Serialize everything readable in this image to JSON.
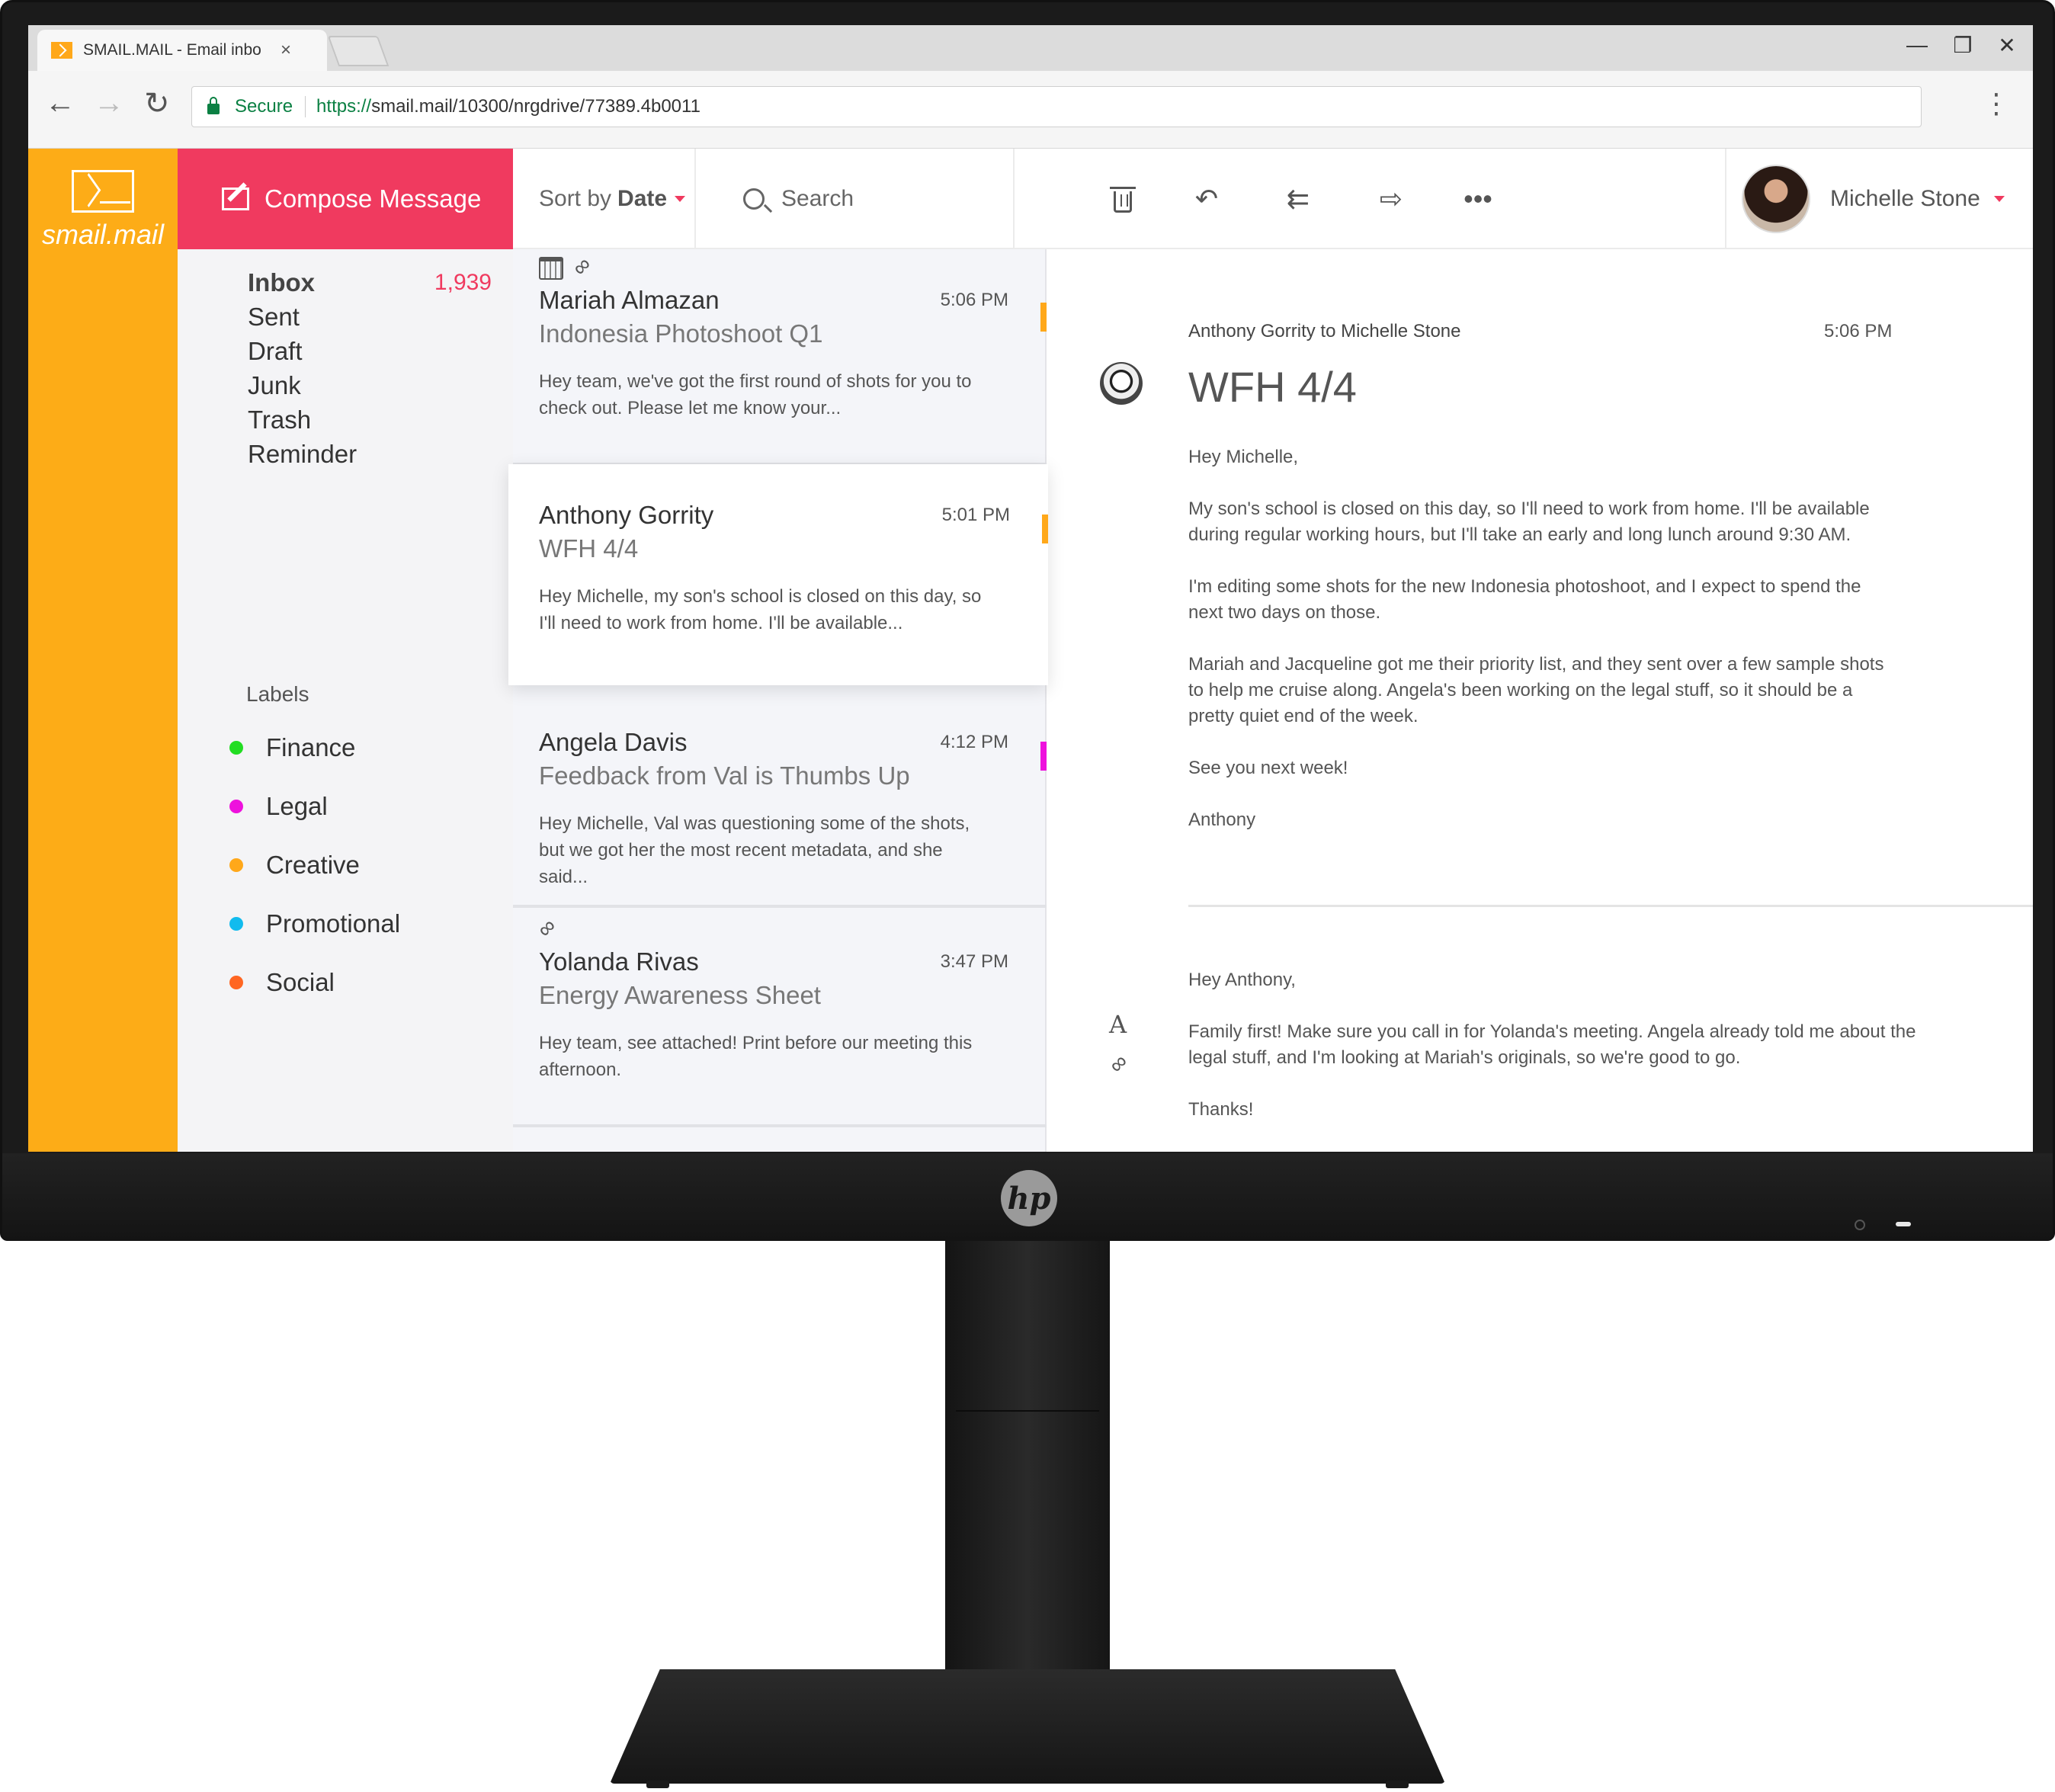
{
  "browser": {
    "tab_title": "SMAIL.MAIL - Email inbo",
    "tab_close": "×",
    "secure_label": "Secure",
    "url_scheme": "https://",
    "url_rest": "smail.mail/10300/nrgdrive/77389.4b0011",
    "window_controls": [
      "—",
      "❐",
      "✕"
    ]
  },
  "app": {
    "brand_name": "smail.mail",
    "compose_label": "Compose Message",
    "folders": [
      {
        "label": "Inbox",
        "count": "1,939"
      },
      {
        "label": "Sent"
      },
      {
        "label": "Draft"
      },
      {
        "label": "Junk"
      },
      {
        "label": "Trash"
      },
      {
        "label": "Reminder"
      }
    ],
    "labels_title": "Labels",
    "labels": [
      {
        "label": "Finance",
        "color": "#22dd22"
      },
      {
        "label": "Legal",
        "color": "#ee11dd"
      },
      {
        "label": "Creative",
        "color": "#ffa81a"
      },
      {
        "label": "Promotional",
        "color": "#11bbee"
      },
      {
        "label": "Social",
        "color": "#ff6622"
      }
    ]
  },
  "toolbar": {
    "sort_prefix": "Sort by",
    "sort_value": "Date",
    "search_placeholder": "Search",
    "actions": [
      "delete-icon",
      "reply-icon",
      "reply-all-icon",
      "forward-icon",
      "more-icon"
    ]
  },
  "user": {
    "name": "Michelle Stone"
  },
  "messages": [
    {
      "sender": "Mariah Almazan",
      "subject": "Indonesia Photoshoot Q1",
      "time": "5:06 PM",
      "preview": "Hey team, we've got the first round of shots for you to check out. Please let me know your...",
      "flag_color": "#ffa81a",
      "icons": [
        "calendar-icon",
        "link-icon"
      ]
    },
    {
      "sender": "Anthony Gorrity",
      "subject": "WFH 4/4",
      "time": "5:01 PM",
      "preview": "Hey Michelle, my son's school is closed on this day, so I'll need to work from home. I'll be available...",
      "flag_color": "#ffa81a",
      "icons": []
    },
    {
      "sender": "Angela Davis",
      "subject": "Feedback from Val is Thumbs Up",
      "time": "4:12 PM",
      "preview": "Hey Michelle, Val was questioning some of the shots, but we got her the most recent metadata, and she said...",
      "flag_color": "#ee11dd",
      "icons": []
    },
    {
      "sender": "Yolanda Rivas",
      "subject": "Energy Awareness Sheet",
      "time": "3:47 PM",
      "preview": "Hey team, see attached! Print before our meeting this afternoon.",
      "flag_color": "",
      "icons": [
        "link-icon"
      ]
    }
  ],
  "reader": {
    "from_line": "Anthony Gorrity to Michelle Stone",
    "time": "5:06 PM",
    "subject": "WFH 4/4",
    "body": [
      "Hey Michelle,",
      "My son's school is closed on this day, so I'll need to work from home. I'll be available during regular working hours, but I'll take an early and long lunch around 9:30 AM.",
      "I'm editing some shots for the new Indonesia photoshoot, and I expect to spend the next two days on those.",
      "Mariah and Jacqueline got me their priority list, and they sent over a few sample shots to help me cruise along. Angela's been working on the legal stuff, so it should be a pretty quiet end of the week.",
      "See you next week!",
      "Anthony"
    ],
    "reply": [
      "Hey Anthony,",
      "Family first! Make sure you call in for Yolanda's meeting. Angela already told me about the legal stuff, and I'm looking at Mariah's originals, so we're good to go.",
      "Thanks!"
    ]
  },
  "monitor": {
    "logo": "hp"
  }
}
